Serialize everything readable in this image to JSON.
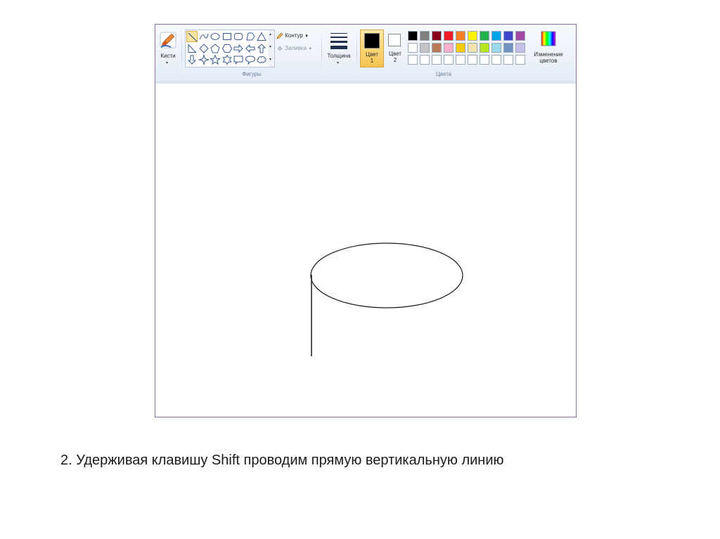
{
  "ribbon": {
    "brushes_label": "Кисти",
    "outline_label": "Контур",
    "fill_label": "Заливка",
    "shapes_group_label": "Фигуры",
    "thickness_label": "Толщина",
    "color1_label_line1": "Цвет",
    "color1_label_line2": "1",
    "color2_label_line1": "Цвет",
    "color2_label_line2": "2",
    "colors_group_label": "Цвета",
    "edit_colors_line1": "Изменение",
    "edit_colors_line2": "цветов",
    "shapes": [
      "line-icon",
      "curve-icon",
      "oval-icon",
      "rectangle-icon",
      "rounded-rectangle-icon",
      "polygon-icon",
      "triangle-icon",
      "right-triangle-icon",
      "diamond-icon",
      "pentagon-icon",
      "hexagon-icon",
      "arrow-right-icon",
      "arrow-left-icon",
      "arrow-up-icon",
      "arrow-down-icon",
      "star4-icon",
      "star5-icon",
      "star6-icon",
      "callout-rect-icon",
      "callout-oval-icon",
      "callout-cloud-icon"
    ],
    "selected_shape": "line-icon",
    "color1": "#000000",
    "color2": "#ffffff",
    "palette_row1": [
      "#000000",
      "#7f7f7f",
      "#880015",
      "#ed1c24",
      "#ff7f27",
      "#fff200",
      "#22b14c",
      "#00a2e8",
      "#3f48cc",
      "#a349a4"
    ],
    "palette_row2": [
      "#ffffff",
      "#c3c3c3",
      "#b97a57",
      "#ffaec9",
      "#ffc90e",
      "#efe4b0",
      "#b5e61d",
      "#99d9ea",
      "#7092be",
      "#c8bfe7"
    ],
    "palette_row3": [
      "#ffffff",
      "#ffffff",
      "#ffffff",
      "#ffffff",
      "#ffffff",
      "#ffffff",
      "#ffffff",
      "#ffffff",
      "#ffffff",
      "#ffffff"
    ]
  },
  "caption": "2. Удерживая клавишу Shift проводим прямую вертикальную линию"
}
